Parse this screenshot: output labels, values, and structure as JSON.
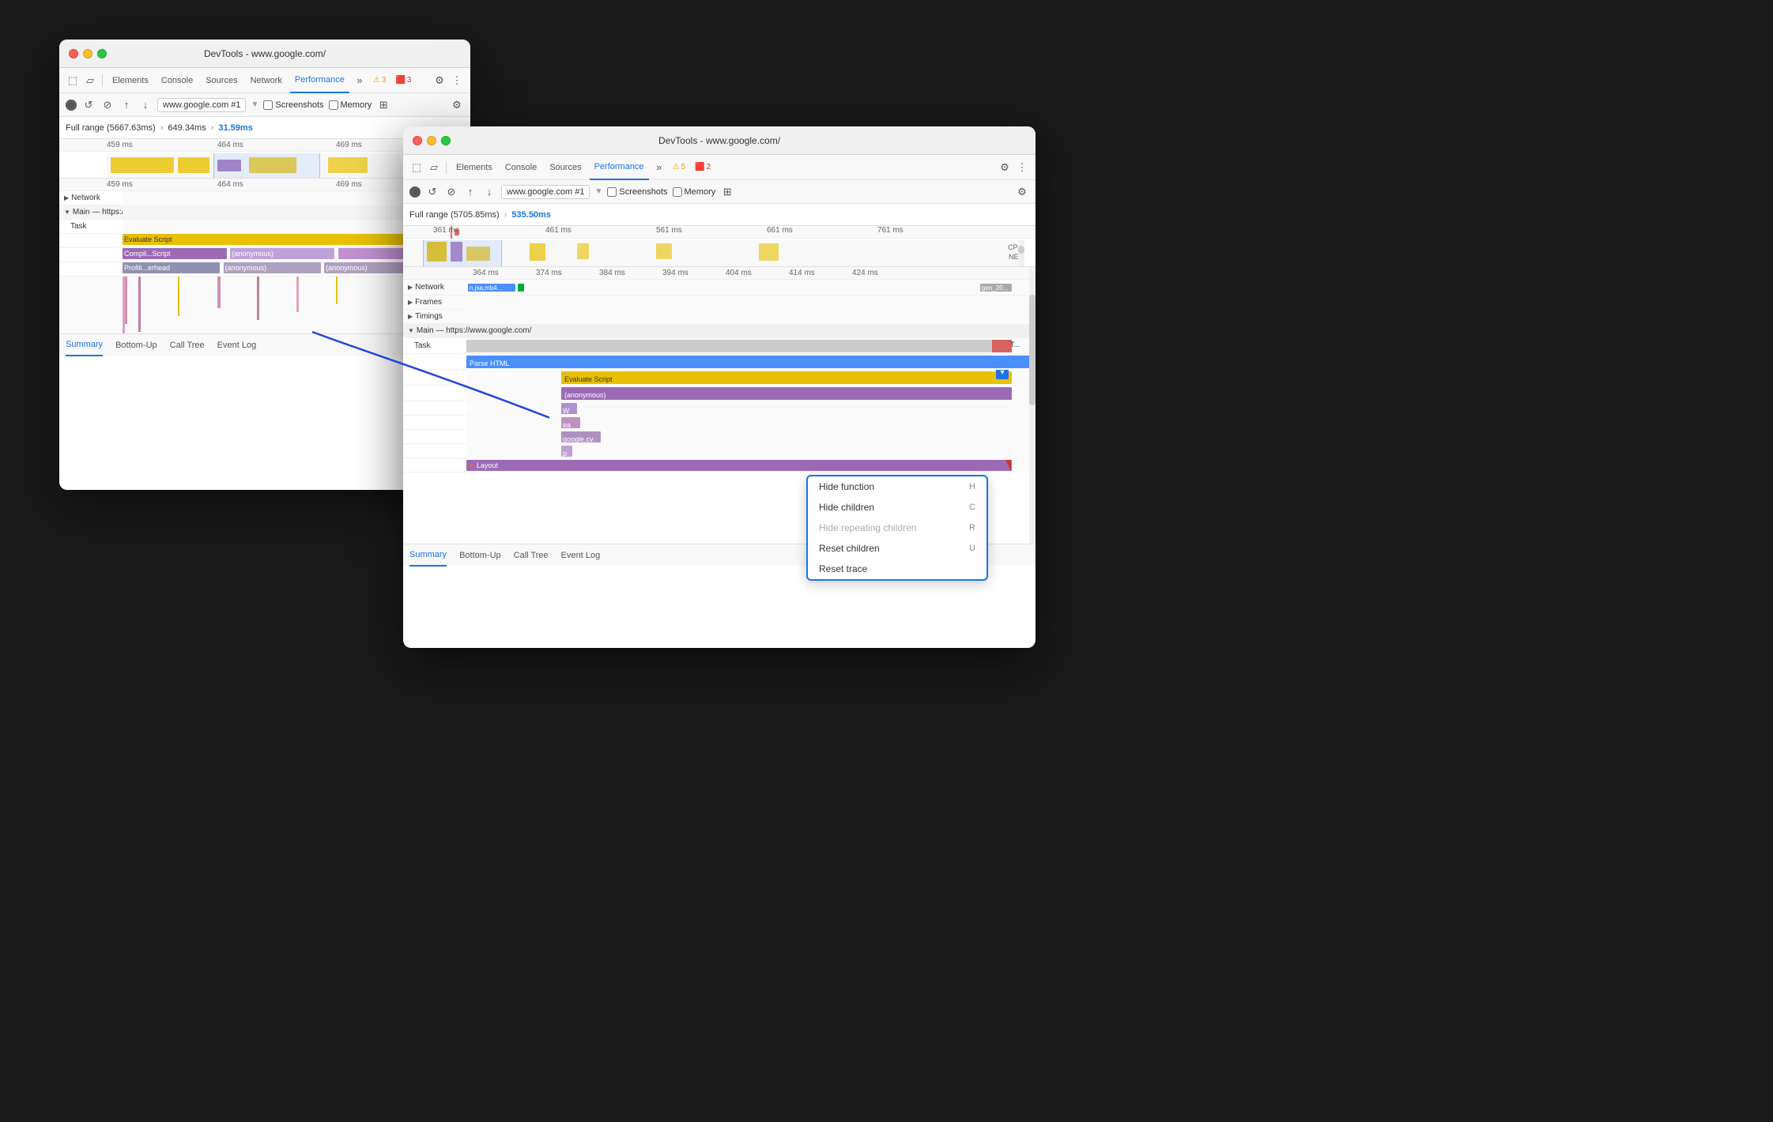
{
  "bg_window": {
    "title": "DevTools - www.google.com/",
    "tabs": [
      "Elements",
      "Console",
      "Sources",
      "Network",
      "Performance"
    ],
    "active_tab": "Performance",
    "badge_warn": "3",
    "badge_err": "3",
    "url": "www.google.com #1",
    "screenshots_label": "Screenshots",
    "memory_label": "Memory",
    "full_range": "Full range (5667.63ms)",
    "arrow": ">",
    "range_start": "649.34ms",
    "arrow2": ">",
    "range_highlight": "31.59ms",
    "time_ticks_top": [
      "459 ms",
      "464 ms",
      "469 ms"
    ],
    "time_ticks_mid": [
      "459 ms",
      "464 ms",
      "469 ms"
    ],
    "sections": {
      "network": "Network",
      "main": "Main — https://www.google.com/"
    },
    "task_label": "Task",
    "evaluate_script": "Evaluate Script",
    "compil_script": "Compil...Script",
    "anonymous": "(anonymous)",
    "profil_erhead": "Profili...erhead",
    "anonymous2": "(anonymous)",
    "anonymous3": "(anonymous)"
  },
  "fg_window": {
    "title": "DevTools - www.google.com/",
    "tabs": [
      "Elements",
      "Console",
      "Sources",
      "Performance"
    ],
    "active_tab": "Performance",
    "badge_warn": "5",
    "badge_err": "2",
    "url": "www.google.com #1",
    "screenshots_label": "Screenshots",
    "memory_label": "Memory",
    "full_range": "Full range (5705.85ms)",
    "arrow": ">",
    "range_highlight": "535.50ms",
    "time_ticks": [
      "361 ms",
      "461 ms",
      "561 ms",
      "661 ms",
      "761 ms"
    ],
    "time_ticks_mid": [
      "364 ms",
      "374 ms",
      "384 ms",
      "394 ms",
      "404 ms",
      "414 ms",
      "424 ms"
    ],
    "sections": {
      "network": "Network",
      "frames": "Frames",
      "timings": "Timings",
      "main": "Main — https://www.google.com/"
    },
    "network_files": "n,jsa,mb4...",
    "gen_label": "gen_20...",
    "task_label": "Task",
    "t_label": "T...",
    "parse_html": "Parse HTML",
    "evaluate_script": "Evaluate Script",
    "anonymous": "(anonymous)",
    "w_label": "W",
    "ea_label": "ea",
    "google_cv": "google.cv",
    "p_label": "p",
    "layout": "Layout",
    "cpu_label": "CPU",
    "net_label": "NET",
    "summary_label": "Summary",
    "bottom_up_label": "Bottom-Up",
    "call_tree_label": "Call Tree",
    "event_log_label": "Event Log"
  },
  "context_menu": {
    "items": [
      {
        "label": "Hide function",
        "shortcut": "H",
        "disabled": false
      },
      {
        "label": "Hide children",
        "shortcut": "C",
        "disabled": false
      },
      {
        "label": "Hide repeating children",
        "shortcut": "R",
        "disabled": true
      },
      {
        "label": "Reset children",
        "shortcut": "U",
        "disabled": false
      },
      {
        "label": "Reset trace",
        "shortcut": "",
        "disabled": false
      }
    ]
  }
}
